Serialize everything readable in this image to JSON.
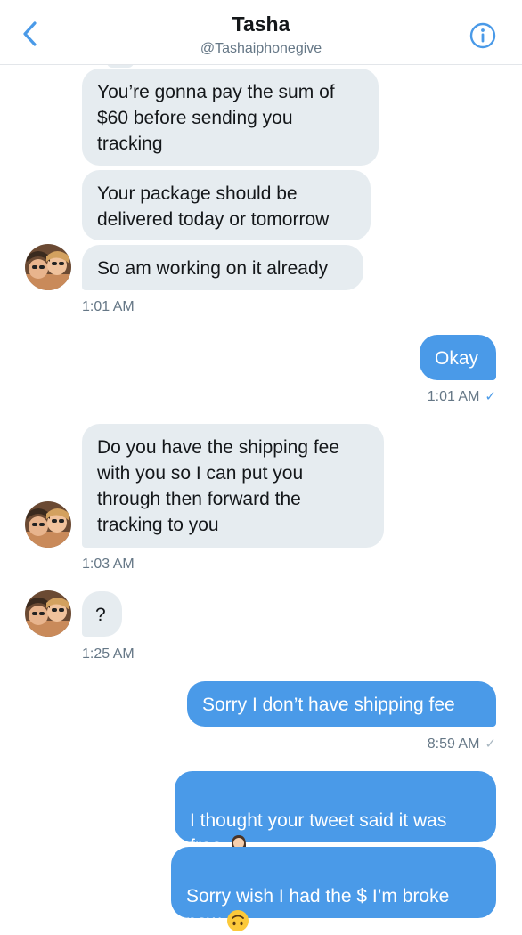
{
  "header": {
    "title": "Tasha",
    "handle": "@Tashaiphonegive"
  },
  "icons": {
    "back": "chevron-left-icon",
    "info": "info-icon",
    "read": "checkmark-icon"
  },
  "colors": {
    "accent": "#4a9ae8",
    "incoming_bubble": "#e6ecf0",
    "timestamp": "#657786"
  },
  "messages": {
    "m1": "You’re gonna pay the sum of\n$60 before sending you\ntracking",
    "m2": "Your package should be\ndelivered today or tomorrow",
    "m3": "So am working on it already",
    "t1": "1:01 AM",
    "m4": "Okay",
    "t2": "1:01 AM",
    "m5": "Do you have the shipping fee\nwith you so I can put you\nthrough then forward the\ntracking to you",
    "t3": "1:03 AM",
    "m6": "?",
    "t4": "1:25 AM",
    "m7": "Sorry I don’t have shipping fee",
    "t5": "8:59 AM",
    "m8": "I thought your tweet said it was\nfree",
    "m9": "Sorry wish I had the $ I’m broke\nnow"
  }
}
